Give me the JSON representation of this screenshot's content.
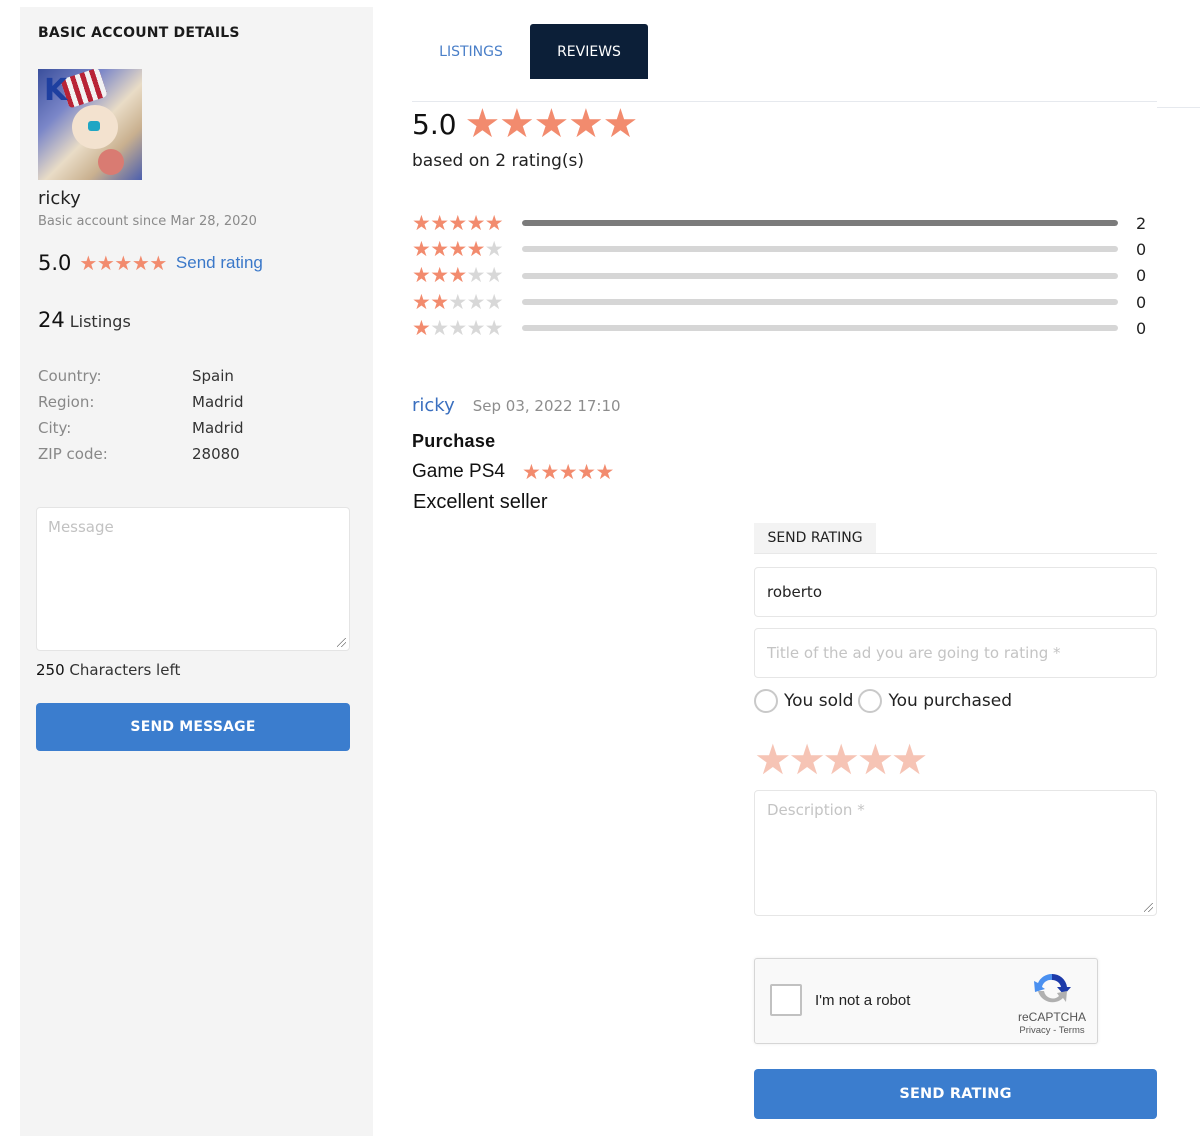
{
  "sidebar": {
    "title": "BASIC ACCOUNT DETAILS",
    "avatar_alt": "user avatar (anime character artwork)",
    "username": "ricky",
    "account_since": "Basic account since Mar 28, 2020",
    "rating": {
      "score": "5.0",
      "stars": 5,
      "max_stars": 5,
      "send_rating_link": "Send rating"
    },
    "listings": {
      "count": "24",
      "label": "Listings"
    },
    "details": [
      {
        "label": "Country:",
        "value": "Spain"
      },
      {
        "label": "Region:",
        "value": "Madrid"
      },
      {
        "label": "City:",
        "value": "Madrid"
      },
      {
        "label": "ZIP code:",
        "value": "28080"
      }
    ],
    "message": {
      "placeholder": "Message",
      "value": ""
    },
    "chars_left": {
      "count": "250",
      "label": "Characters left"
    },
    "send_message_button": "SEND MESSAGE"
  },
  "tabs": [
    {
      "label": "LISTINGS",
      "active": false
    },
    {
      "label": "REVIEWS",
      "active": true
    }
  ],
  "reviews_summary": {
    "score": "5.0",
    "stars": 5,
    "based_on": "based on 2 rating(s)",
    "breakdown": [
      {
        "stars": 5,
        "count": "2",
        "fraction": 1.0
      },
      {
        "stars": 4,
        "count": "0",
        "fraction": 0
      },
      {
        "stars": 3,
        "count": "0",
        "fraction": 0
      },
      {
        "stars": 2,
        "count": "0",
        "fraction": 0
      },
      {
        "stars": 1,
        "count": "0",
        "fraction": 0
      }
    ]
  },
  "review": {
    "author": "ricky",
    "date": "Sep 03, 2022 17:10",
    "type": "Purchase",
    "item": "Game PS4",
    "stars": 5,
    "text": "Excellent seller"
  },
  "send_rating_form": {
    "tab_label": "SEND RATING",
    "name_value": "roberto",
    "title_placeholder": "Title of the ad you are going to rating *",
    "radio_options": [
      "You sold",
      "You purchased"
    ],
    "rating_stars": 5,
    "description_placeholder": "Description *",
    "recaptcha": {
      "label": "I'm not a robot",
      "brand": "reCAPTCHA",
      "links": "Privacy - Terms"
    },
    "submit_button": "SEND RATING"
  },
  "colors": {
    "star_active": "#f28b6e",
    "star_inactive": "#d8d8d8",
    "star_form": "#f6c4b5",
    "primary_button": "#3b7dce",
    "active_tab": "#0c1f38",
    "link": "#3a78c9"
  }
}
